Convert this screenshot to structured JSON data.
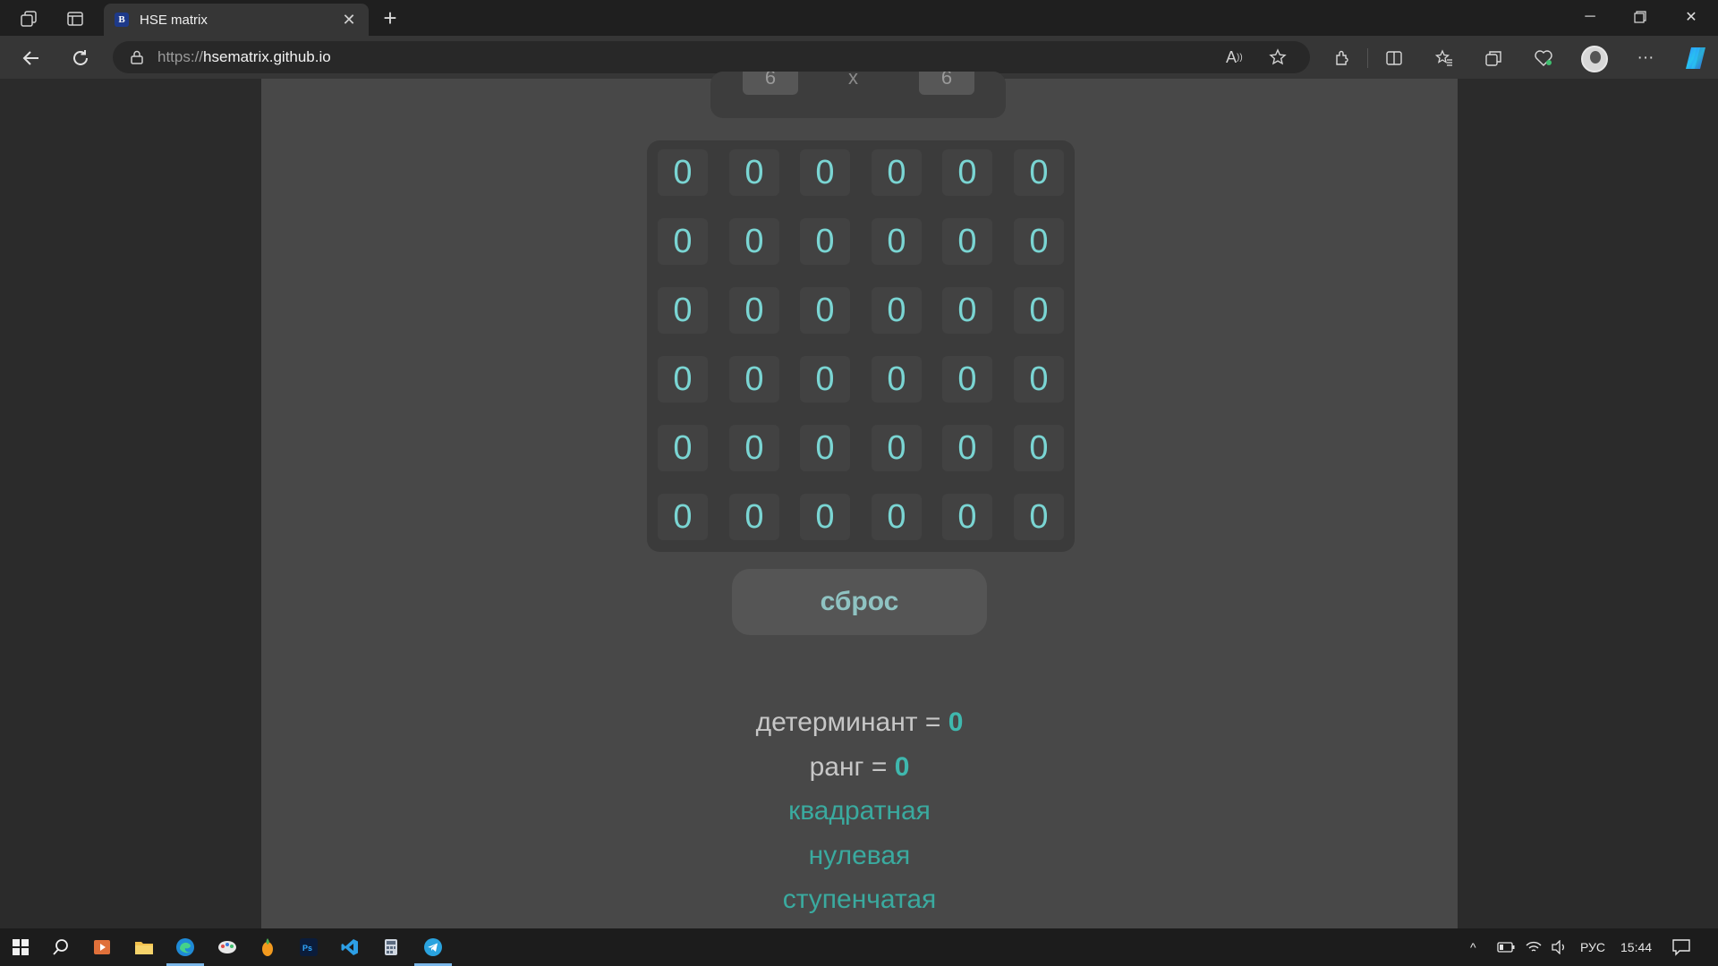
{
  "browser": {
    "tab_title": "HSE matrix",
    "tab_favicon": "В",
    "url_protocol": "https://",
    "url_host": "hsematrix.github.io"
  },
  "matrix": {
    "rows": [
      [
        "0",
        "0",
        "0",
        "0",
        "0",
        "0"
      ],
      [
        "0",
        "0",
        "0",
        "0",
        "0",
        "0"
      ],
      [
        "0",
        "0",
        "0",
        "0",
        "0",
        "0"
      ],
      [
        "0",
        "0",
        "0",
        "0",
        "0",
        "0"
      ],
      [
        "0",
        "0",
        "0",
        "0",
        "0",
        "0"
      ],
      [
        "0",
        "0",
        "0",
        "0",
        "0",
        "0"
      ]
    ]
  },
  "top_panel": {
    "left_value": "6",
    "separator": "x",
    "right_value": "6"
  },
  "reset_label": "сброс",
  "results": {
    "determinant_label": "детерминант = ",
    "determinant_value": "0",
    "rank_label": "ранг = ",
    "rank_value": "0",
    "properties": [
      "квадратная",
      "нулевая",
      "ступенчатая"
    ]
  },
  "taskbar": {
    "language": "РУС",
    "time": "15:44"
  },
  "colors": {
    "cell_text": "#7ad5d3",
    "accent": "#3fb8ae",
    "page_bg": "#484848"
  }
}
